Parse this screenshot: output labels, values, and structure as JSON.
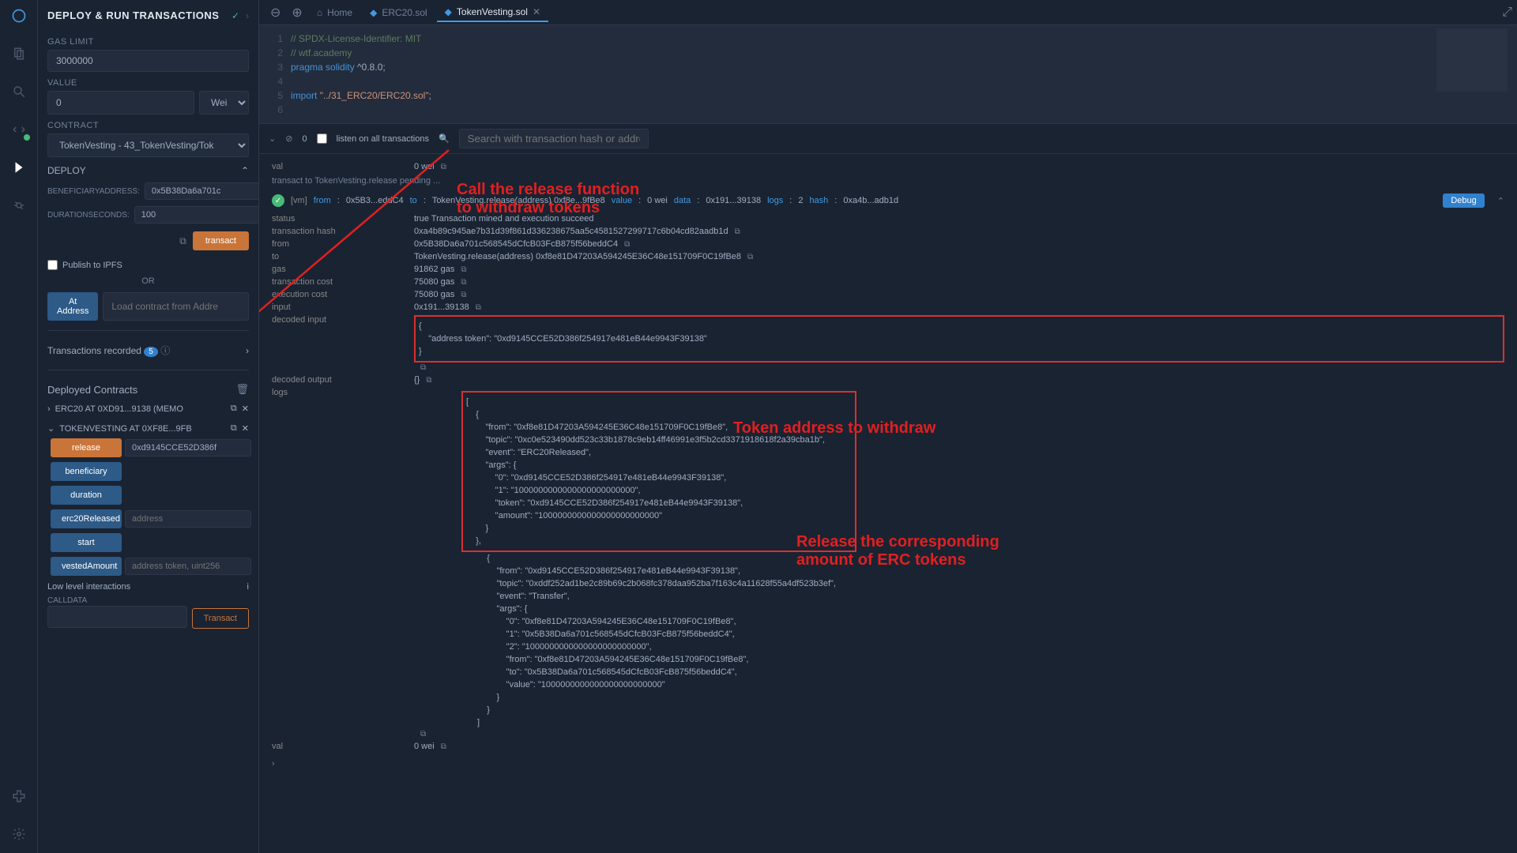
{
  "header": {
    "title": "DEPLOY & RUN TRANSACTIONS"
  },
  "sidebar": {
    "gasLimitLabel": "GAS LIMIT",
    "gasLimit": "3000000",
    "valueLabel": "VALUE",
    "value": "0",
    "valueUnit": "Wei",
    "contractLabel": "CONTRACT",
    "contract": "TokenVesting - 43_TokenVesting/Tok",
    "deployLabel": "DEPLOY",
    "params": {
      "beneficiaryLabel": "BENEFICIARYADDRESS:",
      "beneficiary": "0x5B38Da6a701c",
      "durationLabel": "DURATIONSECONDS:",
      "duration": "100"
    },
    "transactLabel": "transact",
    "publishIPFS": "Publish to IPFS",
    "orLabel": "OR",
    "atAddressLabel": "At Address",
    "atAddressPlaceholder": "Load contract from Addre",
    "txRecordedLabel": "Transactions recorded",
    "txRecordedCount": "5",
    "deployedLabel": "Deployed Contracts",
    "contracts": [
      {
        "name": "ERC20 AT 0XD91...9138 (MEMO"
      },
      {
        "name": "TOKENVESTING AT 0XF8E...9FB"
      }
    ],
    "funcs": {
      "release": "release",
      "releaseParam": "0xd9145CCE52D386f",
      "beneficiary": "beneficiary",
      "duration": "duration",
      "erc20Released": "erc20Released",
      "erc20ReleasedPh": "address",
      "start": "start",
      "vestedAmount": "vestedAmount",
      "vestedAmountPh": "address token, uint256"
    },
    "lowLevelLabel": "Low level interactions",
    "calldataLabel": "CALLDATA",
    "transactBtnLabel": "Transact"
  },
  "tabs": {
    "home": "Home",
    "erc20": "ERC20.sol",
    "vesting": "TokenVesting.sol"
  },
  "editor": {
    "l1": "// SPDX-License-Identifier: MIT",
    "l2": "// wtf.academy",
    "l3a": "pragma ",
    "l3b": "solidity ",
    "l3c": "^0.8.0;",
    "l5a": "import ",
    "l5b": "\"../31_ERC20/ERC20.sol\"",
    "l5c": ";"
  },
  "terminal": {
    "count": "0",
    "listenLabel": "listen on all transactions",
    "searchPlaceholder": "Search with transaction hash or address"
  },
  "console": {
    "valLabel": "val",
    "valValue": "0 wei",
    "pendingMsg": "transact to TokenVesting.release pending ...",
    "summaryFrom": "from",
    "summaryFromVal": "0x5B3...eddC4",
    "summaryTo": "to",
    "summaryToVal": "TokenVesting.release(address) 0xf8e...9fBe8",
    "summaryValue": "value",
    "summaryValueVal": "0 wei",
    "summaryData": "data",
    "summaryDataVal": "0x191...39138",
    "summaryLogs": "logs",
    "summaryLogsVal": "2",
    "summaryHash": "hash",
    "summaryHashVal": "0xa4b...adb1d",
    "status": {
      "k": "status",
      "v": "true Transaction mined and execution succeed"
    },
    "txhash": {
      "k": "transaction hash",
      "v": "0xa4b89c945ae7b31d39f861d336238675aa5c4581527299717c6b04cd82aadb1d"
    },
    "from": {
      "k": "from",
      "v": "0x5B38Da6a701c568545dCfcB03FcB875f56beddC4"
    },
    "to": {
      "k": "to",
      "v": "TokenVesting.release(address) 0xf8e81D47203A594245E36C48e151709F0C19fBe8"
    },
    "gas": {
      "k": "gas",
      "v": "91862 gas"
    },
    "txcost": {
      "k": "transaction cost",
      "v": "75080 gas"
    },
    "execost": {
      "k": "execution cost",
      "v": "75080 gas"
    },
    "input": {
      "k": "input",
      "v": "0x191...39138"
    },
    "decInput": {
      "k": "decoded input",
      "v": "{\n    \"address token\": \"0xd9145CCE52D386f254917e481eB44e9943F39138\"\n}"
    },
    "decOutput": {
      "k": "decoded output",
      "v": "{}"
    },
    "logs": {
      "k": "logs"
    },
    "log1": "[\n    {\n        \"from\": \"0xf8e81D47203A594245E36C48e151709F0C19fBe8\",\n        \"topic\": \"0xc0e523490dd523c33b1878c9eb14ff46991e3f5b2cd3371918618f2a39cba1b\",\n        \"event\": \"ERC20Released\",\n        \"args\": {\n            \"0\": \"0xd9145CCE52D386f254917e481eB44e9943F39138\",\n            \"1\": \"1000000000000000000000000\",\n            \"token\": \"0xd9145CCE52D386f254917e481eB44e9943F39138\",\n            \"amount\": \"1000000000000000000000000\"\n        }\n    },",
    "log2": "    {\n        \"from\": \"0xd9145CCE52D386f254917e481eB44e9943F39138\",\n        \"topic\": \"0xddf252ad1be2c89b69c2b068fc378daa952ba7f163c4a11628f55a4df523b3ef\",\n        \"event\": \"Transfer\",\n        \"args\": {\n            \"0\": \"0xf8e81D47203A594245E36C48e151709F0C19fBe8\",\n            \"1\": \"0x5B38Da6a701c568545dCfcB03FcB875f56beddC4\",\n            \"2\": \"1000000000000000000000000\",\n            \"from\": \"0xf8e81D47203A594245E36C48e151709F0C19fBe8\",\n            \"to\": \"0x5B38Da6a701c568545dCfcB03FcB875f56beddC4\",\n            \"value\": \"1000000000000000000000000\"\n        }\n    }\n]",
    "val2": {
      "k": "val",
      "v": "0 wei"
    },
    "debug": "Debug",
    "vm": "[vm]"
  },
  "annotations": {
    "a1": "Call the release function\nto withdraw tokens",
    "a2": "Token address to withdraw",
    "a3": "Release the corresponding\namount of ERC tokens"
  }
}
